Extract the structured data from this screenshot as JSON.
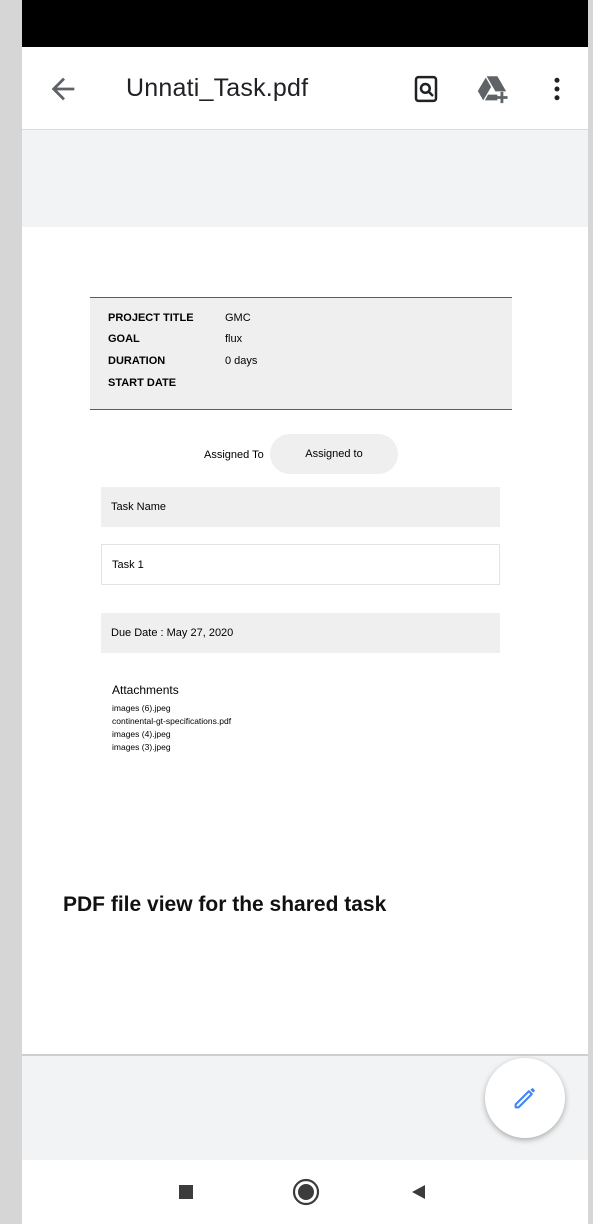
{
  "app_bar": {
    "title": "Unnati_Task.pdf"
  },
  "icons": {
    "back": "arrow-left-icon",
    "find": "find-in-page-icon",
    "drive": "add-to-drive-icon",
    "more": "more-vert-icon",
    "edit": "pencil-icon"
  },
  "document": {
    "info": [
      {
        "label": "PROJECT TITLE",
        "value": "GMC"
      },
      {
        "label": "GOAL",
        "value": "flux"
      },
      {
        "label": "DURATION",
        "value": "0 days"
      },
      {
        "label": "START DATE",
        "value": ""
      }
    ],
    "assigned_label": "Assigned To",
    "assigned_value": "Assigned to",
    "task_header": "Task Name",
    "tasks": [
      "Task 1"
    ],
    "due_date": "Due Date : May 27, 2020",
    "attachments_title": "Attachments",
    "attachments": [
      "images (6).jpeg",
      "continental-gt-specifications.pdf",
      "images (4).jpeg",
      "images (3).jpeg"
    ],
    "caption": "PDF file view for the shared task"
  },
  "colors": {
    "accent_blue": "#4285f4",
    "divider_red": "#c0303a",
    "cell_gray": "#efefef"
  }
}
